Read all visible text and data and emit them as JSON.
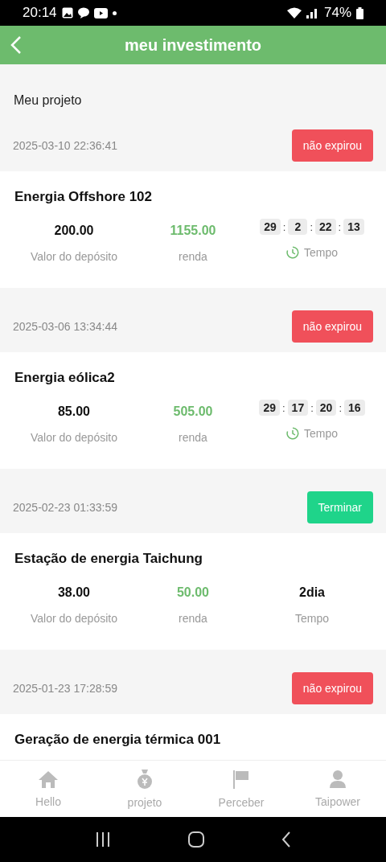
{
  "status_bar": {
    "time": "20:14",
    "battery": "74%"
  },
  "header": {
    "title": "meu investimento"
  },
  "section_title": "Meu projeto",
  "investments": [
    {
      "date": "2025-03-10 22:36:41",
      "badge": {
        "label": "não expirou",
        "kind": "active"
      },
      "name": "Energia Offshore 102",
      "deposit": "200.00",
      "deposit_label": "Valor do depósito",
      "income": "1155.00",
      "income_label": "renda",
      "time": {
        "kind": "countdown",
        "segments": [
          "29",
          "2",
          "22",
          "13"
        ],
        "separator": ":",
        "label": "Tempo"
      }
    },
    {
      "date": "2025-03-06 13:34:44",
      "badge": {
        "label": "não expirou",
        "kind": "active"
      },
      "name": "Energia eólica2",
      "deposit": "85.00",
      "deposit_label": "Valor do depósito",
      "income": "505.00",
      "income_label": "renda",
      "time": {
        "kind": "countdown",
        "segments": [
          "29",
          "17",
          "20",
          "16"
        ],
        "separator": ":",
        "label": "Tempo"
      }
    },
    {
      "date": "2025-02-23 01:33:59",
      "badge": {
        "label": "Terminar",
        "kind": "done"
      },
      "name": "Estação de energia Taichung",
      "deposit": "38.00",
      "deposit_label": "Valor do depósito",
      "income": "50.00",
      "income_label": "renda",
      "time": {
        "kind": "duration",
        "value": "2dia",
        "label": "Tempo"
      }
    },
    {
      "date": "2025-01-23 17:28:59",
      "badge": {
        "label": "não expirou",
        "kind": "active"
      },
      "name": "Geração de energia térmica 001"
    }
  ],
  "tab_bar": [
    {
      "label": "Hello",
      "selected": false
    },
    {
      "label": "projeto",
      "selected": false
    },
    {
      "label": "Perceber",
      "selected": false
    },
    {
      "label": "Taipower",
      "selected": false
    }
  ]
}
